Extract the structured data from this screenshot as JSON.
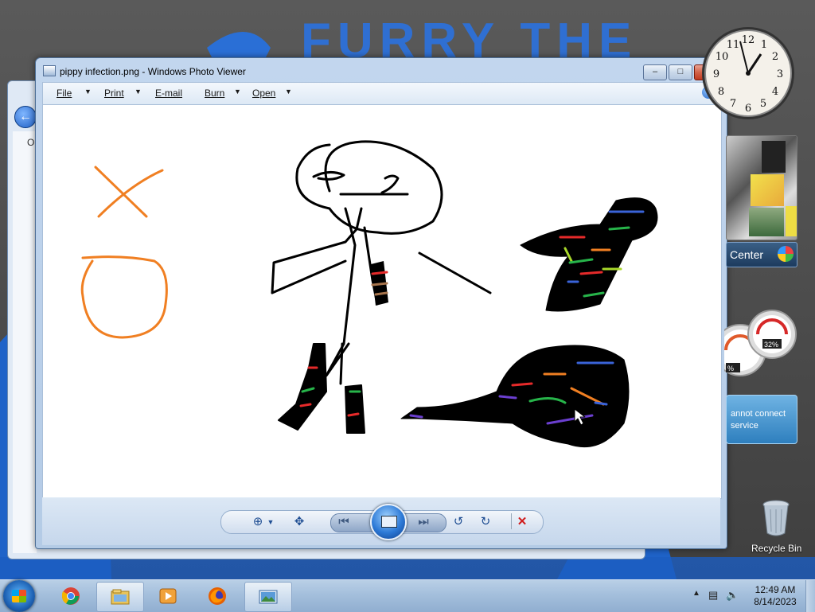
{
  "desktop": {
    "wallpaper_text": "FURRY THE"
  },
  "background_window": {
    "sidebar_letter": "O"
  },
  "photo_viewer": {
    "title": "pippy infection.png - Windows Photo Viewer",
    "menu": [
      {
        "label": "File"
      },
      {
        "label": "Print"
      },
      {
        "label": "E-mail"
      },
      {
        "label": "Burn"
      },
      {
        "label": "Open"
      }
    ],
    "help_label": "?",
    "controls": {
      "zoom_icon": "zoom-icon",
      "fit_icon": "actual-size-icon",
      "prev_icon": "previous-icon",
      "slideshow_icon": "slideshow-icon",
      "next_icon": "next-icon",
      "rotate_ccw_icon": "rotate-counterclockwise-icon",
      "rotate_cw_icon": "rotate-clockwise-icon",
      "delete_icon": "delete-icon"
    },
    "drawing_colors": {
      "orange": "#f07f22",
      "black": "#000000",
      "red": "#e52a2a",
      "green": "#27b44a",
      "blue": "#3a63d8",
      "purple": "#6b3fd0",
      "lime": "#a8d82a",
      "brown": "#a7744c"
    }
  },
  "gadgets": {
    "clock_numbers": [
      "12",
      "1",
      "2",
      "3",
      "4",
      "5",
      "6",
      "7",
      "8",
      "9",
      "10",
      "11"
    ],
    "media_center_label": "Center",
    "meter_left": "%",
    "meter_right": "32%",
    "feed_text_1": "annot connect",
    "feed_text_2": "service"
  },
  "recycle_bin": {
    "label": "Recycle Bin"
  },
  "taskbar": {
    "time": "12:49 AM",
    "date": "8/14/2023",
    "pinned": [
      {
        "name": "chrome-icon"
      },
      {
        "name": "explorer-icon"
      },
      {
        "name": "media-player-icon"
      },
      {
        "name": "firefox-icon"
      },
      {
        "name": "photo-viewer-icon"
      }
    ]
  }
}
